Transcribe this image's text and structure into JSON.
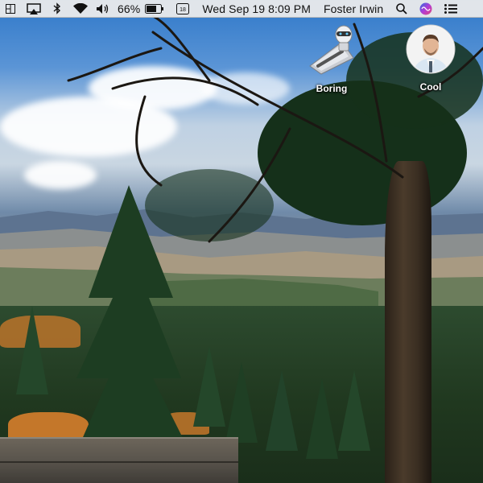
{
  "menubar": {
    "battery_percent": "66%",
    "date_time": "Wed Sep 19  8:09 PM",
    "user_name": "Foster Irwin",
    "icons": [
      "window-tiling-icon",
      "airplay-icon",
      "bluetooth-icon",
      "wifi-icon",
      "volume-icon",
      "battery-icon",
      "keyboard-input-icon",
      "spotlight-search-icon",
      "siri-icon",
      "notification-center-icon"
    ]
  },
  "desktop": {
    "icons": [
      {
        "label": "Boring",
        "icon": "automator-robot-icon"
      },
      {
        "label": "Cool",
        "icon": "profile-photo-icon"
      }
    ]
  }
}
